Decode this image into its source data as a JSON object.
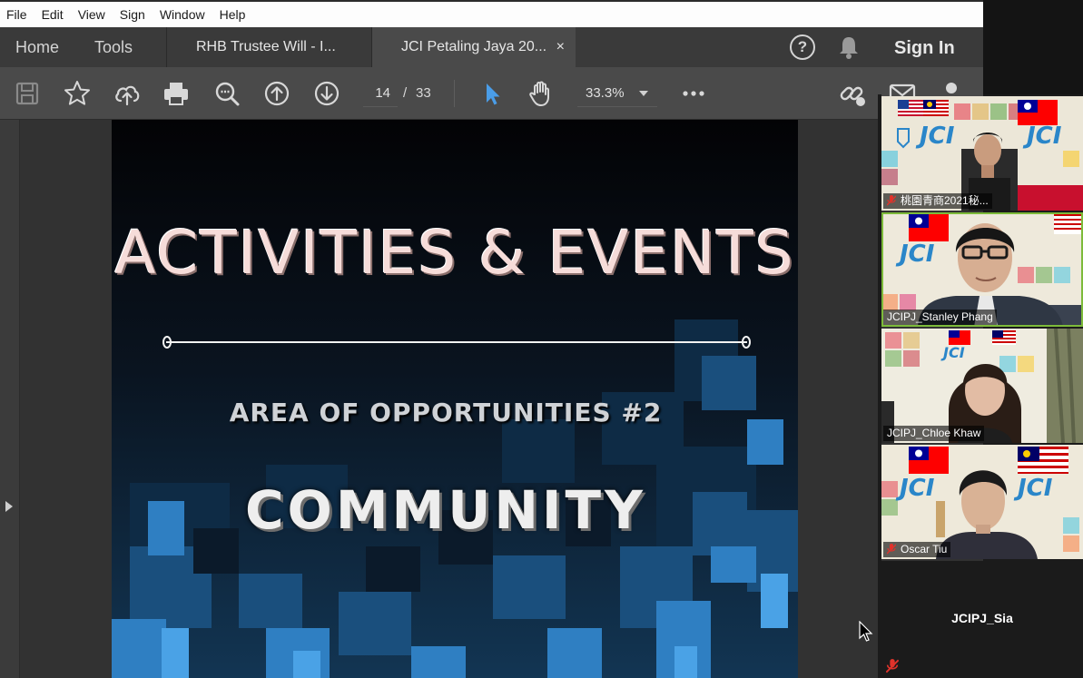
{
  "menu": [
    "File",
    "Edit",
    "View",
    "Sign",
    "Window",
    "Help"
  ],
  "nav": {
    "home": "Home",
    "tools": "Tools"
  },
  "tabs": [
    {
      "label": "RHB Trustee Will - I..."
    },
    {
      "label": "JCI Petaling Jaya 20...",
      "close": "×"
    }
  ],
  "header": {
    "help": "?",
    "sign_in": "Sign In"
  },
  "toolbar": {
    "icons": [
      "save-icon",
      "star-icon",
      "upload-cloud-icon",
      "print-icon",
      "zoom-out-icon",
      "page-up-icon",
      "page-down-icon",
      "select-arrow-icon",
      "hand-icon",
      "more-icon",
      "link-icon",
      "mail-icon",
      "user-icon"
    ],
    "page_current": "14",
    "page_separator": "/",
    "page_total": "33",
    "zoom": "33.3%"
  },
  "slide": {
    "title": "ACTIVITIES & EVENTS",
    "subtitle": "AREA OF OPPORTUNITIES #2",
    "heading": "COMMUNITY"
  },
  "participants": [
    {
      "name": "桃園青商2021秘...",
      "muted": true
    },
    {
      "name": "JCIPJ_Stanley Phang",
      "muted": false,
      "active": true
    },
    {
      "name": "JCIPJ_Chloe Khaw",
      "muted": false
    },
    {
      "name": "Oscar Tiu",
      "muted": true
    },
    {
      "name": "JCIPJ_Sia",
      "muted": true,
      "video": false
    }
  ],
  "colors": {
    "acrobat_toolbar": "#4a4a4a",
    "active_speaker": "#7dbb3a",
    "mic_muted": "#e0332b",
    "jci_blue": "#2a86c9",
    "slide_title": "#f6dcd9"
  }
}
